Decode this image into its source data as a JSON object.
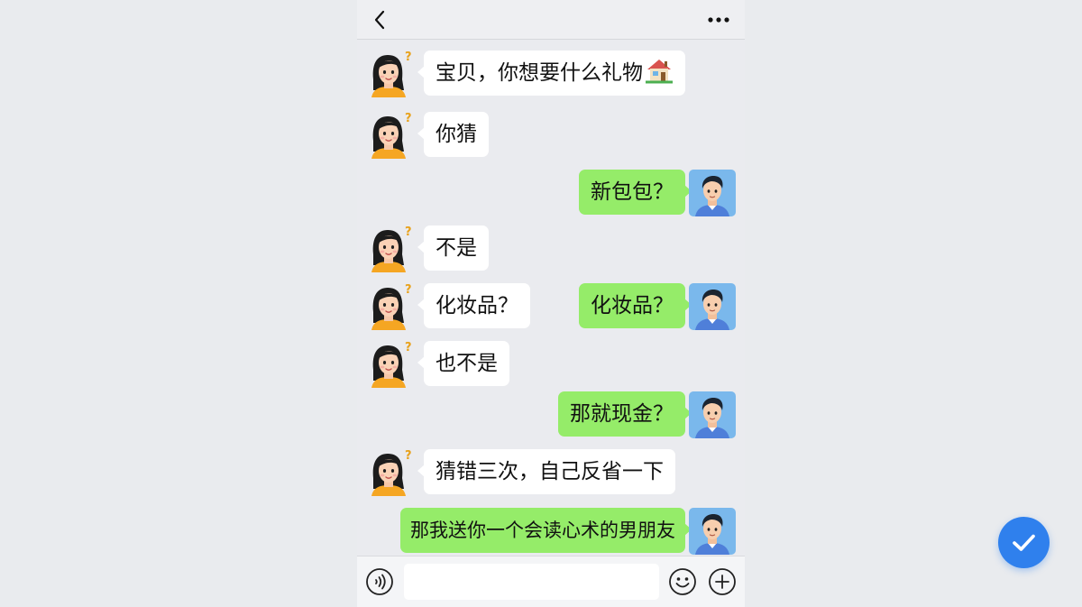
{
  "header": {
    "back_icon": "chevron-left-icon",
    "more_icon": "more-dots-icon"
  },
  "messages": [
    {
      "sender": "her",
      "text": "宝贝，你想要什么礼物",
      "emoji": "house-icon"
    },
    {
      "sender": "her",
      "text": "你猜"
    },
    {
      "sender": "him",
      "text": "新包包？"
    },
    {
      "sender": "her",
      "text": "不是"
    },
    {
      "sender": "her",
      "text": "化妆品？"
    },
    {
      "sender": "him",
      "text": "化妆品？"
    },
    {
      "sender": "her",
      "text": "也不是"
    },
    {
      "sender": "him",
      "text": "那就现金？"
    },
    {
      "sender": "her",
      "text": "猜错三次，自己反省一下"
    },
    {
      "sender": "him",
      "text": "那我送你一个会读心术的男朋友"
    }
  ],
  "input_bar": {
    "message_value": "",
    "voice_icon": "voice-icon",
    "emoji_icon": "smiley-icon",
    "plus_icon": "plus-icon"
  },
  "colors": {
    "incoming_bubble": "#ffffff",
    "outgoing_bubble": "#95ec69",
    "confirm_button": "#2f80ed",
    "her_shirt": "#f5a623",
    "him_avatar_bg": "#7ab8ec"
  },
  "confirm_icon": "check-icon"
}
